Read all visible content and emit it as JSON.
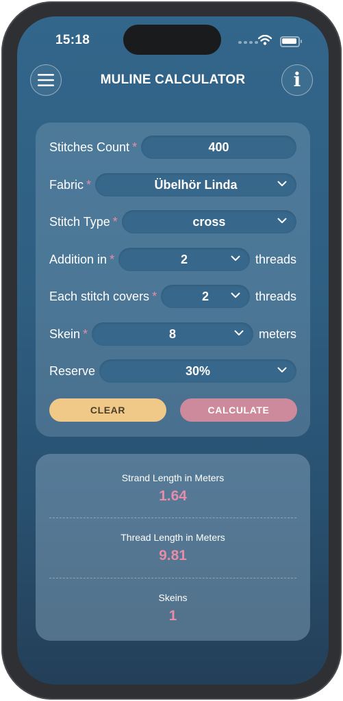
{
  "status_bar": {
    "time": "15:18"
  },
  "header": {
    "title": "MULINE CALCULATOR",
    "menu_icon": "hamburger-menu-icon",
    "info_icon": "info-icon",
    "info_glyph": "i"
  },
  "form": {
    "required_mark": "*",
    "stitches_count": {
      "label": "Stitches Count",
      "value": "400"
    },
    "fabric": {
      "label": "Fabric",
      "value": "Übelhör Linda"
    },
    "stitch_type": {
      "label": "Stitch Type",
      "value": "cross"
    },
    "addition": {
      "label": "Addition in",
      "value": "2",
      "unit": "threads"
    },
    "each_stitch": {
      "label": "Each stitch covers",
      "value": "2",
      "unit": "threads"
    },
    "skein": {
      "label": "Skein",
      "value": "8",
      "unit": "meters"
    },
    "reserve": {
      "label": "Reserve",
      "value": "30%"
    },
    "clear_label": "CLEAR",
    "calculate_label": "CALCULATE"
  },
  "results": {
    "strand": {
      "title": "Strand Length in Meters",
      "value": "1.64"
    },
    "thread": {
      "title": "Thread Length in Meters",
      "value": "9.81"
    },
    "skeins": {
      "title": "Skeins",
      "value": "1"
    }
  },
  "colors": {
    "accent_pink": "#e58da8",
    "clear_button": "#f0c888",
    "calculate_button": "#cd8a9d",
    "background_top": "#32668a",
    "background_bottom": "#243f58"
  }
}
